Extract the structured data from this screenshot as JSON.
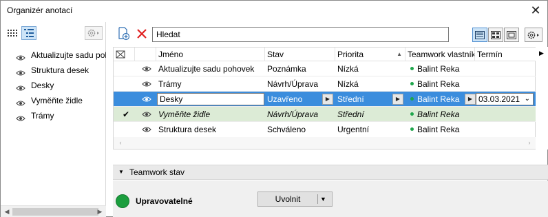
{
  "window": {
    "title": "Organizér anotací",
    "close_glyph": "✕"
  },
  "left_panel": {
    "items": [
      {
        "label": "Aktualizujte sadu pohovek",
        "icon": "eye-icon"
      },
      {
        "label": "Struktura desek",
        "icon": "eye-icon"
      },
      {
        "label": "Desky",
        "icon": "eye-icon"
      },
      {
        "label": "Vyměňte židle",
        "icon": "eye-icon"
      },
      {
        "label": "Trámy",
        "icon": "eye-icon"
      }
    ]
  },
  "toolbar": {
    "search_value": "Hledat",
    "icons": [
      "new-annotation-icon",
      "delete-icon",
      "list-view-icon",
      "grid-view-icon",
      "single-view-icon",
      "gear-icon"
    ]
  },
  "table": {
    "columns": [
      "",
      "",
      "Jméno",
      "Stav",
      "Priorita",
      "Teamwork vlastník",
      "Termín"
    ],
    "sorted_column": "Priorita",
    "rows": [
      {
        "name": "Aktualizujte sadu pohovek",
        "status": "Poznámka",
        "priority": "Nízká",
        "owner": "Balint Reka",
        "date": "",
        "state": "normal"
      },
      {
        "name": "Trámy",
        "status": "Návrh/Úprava",
        "priority": "Nízká",
        "owner": "Balint Reka",
        "date": "",
        "state": "normal"
      },
      {
        "name": "Desky",
        "status": "Uzavřeno",
        "priority": "Střední",
        "owner": "Balint Reka",
        "date": "03.03.2021",
        "state": "selected"
      },
      {
        "name": "Vyměňte židle",
        "status": "Návrh/Úprava",
        "priority": "Střední",
        "owner": "Balint Reka",
        "date": "",
        "state": "done"
      },
      {
        "name": "Struktura desek",
        "status": "Schváleno",
        "priority": "Urgentní",
        "owner": "Balint Reka",
        "date": "",
        "state": "normal"
      }
    ]
  },
  "teamwork": {
    "section_title": "Teamwork stav",
    "status_label": "Upravovatelné",
    "release_label": "Uvolnit"
  },
  "colors": {
    "selection": "#3b8ddd",
    "done_row": "#dcebd6",
    "status_green": "#1b9e3e",
    "delete_red": "#e02020"
  }
}
